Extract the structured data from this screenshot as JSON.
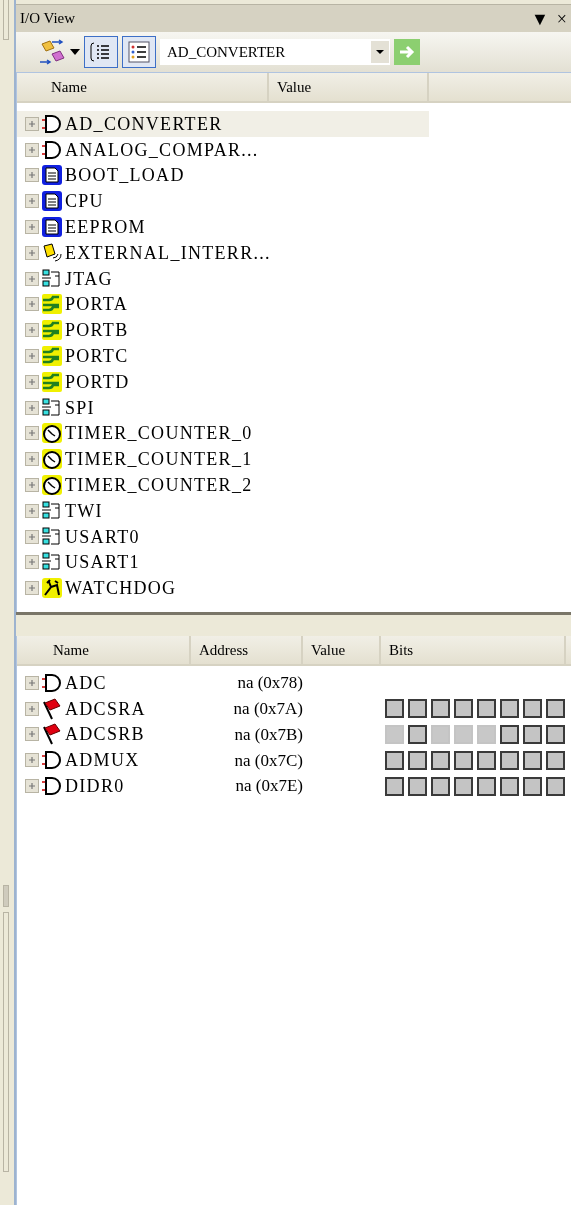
{
  "window": {
    "title": "I/O View",
    "menu_glyph": "▼",
    "close_glyph": "×"
  },
  "toolbar": {
    "view_toggles": [
      {
        "kind": "tree",
        "pressed": true
      },
      {
        "kind": "list",
        "pressed": true
      }
    ],
    "module_select": {
      "value": "AD_CONVERTER"
    }
  },
  "modules": {
    "columns": [
      "Name",
      "Value"
    ],
    "items": [
      {
        "name": "AD_CONVERTER",
        "kind": "gate",
        "selected": true
      },
      {
        "name": "ANALOG_COMPAR...",
        "kind": "gate",
        "selected": false
      },
      {
        "name": "BOOT_LOAD",
        "kind": "doc",
        "selected": false
      },
      {
        "name": "CPU",
        "kind": "doc",
        "selected": false
      },
      {
        "name": "EEPROM",
        "kind": "doc",
        "selected": false
      },
      {
        "name": "EXTERNAL_INTERR...",
        "kind": "bell",
        "selected": false
      },
      {
        "name": "JTAG",
        "kind": "serial",
        "selected": false
      },
      {
        "name": "PORTA",
        "kind": "port",
        "selected": false
      },
      {
        "name": "PORTB",
        "kind": "port",
        "selected": false
      },
      {
        "name": "PORTC",
        "kind": "port",
        "selected": false
      },
      {
        "name": "PORTD",
        "kind": "port",
        "selected": false
      },
      {
        "name": "SPI",
        "kind": "serial",
        "selected": false
      },
      {
        "name": "TIMER_COUNTER_0",
        "kind": "timer",
        "selected": false
      },
      {
        "name": "TIMER_COUNTER_1",
        "kind": "timer",
        "selected": false
      },
      {
        "name": "TIMER_COUNTER_2",
        "kind": "timer",
        "selected": false
      },
      {
        "name": "TWI",
        "kind": "serial",
        "selected": false
      },
      {
        "name": "USART0",
        "kind": "serial",
        "selected": false
      },
      {
        "name": "USART1",
        "kind": "serial",
        "selected": false
      },
      {
        "name": "WATCHDOG",
        "kind": "watchdog",
        "selected": false
      }
    ]
  },
  "registers": {
    "columns": [
      "Name",
      "Address",
      "Value",
      "Bits"
    ],
    "rows": [
      {
        "name": "ADC",
        "kind": "gate",
        "address": "na (0x78)"
      },
      {
        "name": "ADCSRA",
        "kind": "flag",
        "address": "na (0x7A)",
        "bits": [
          {
            "available": true
          },
          {
            "available": true
          },
          {
            "available": true
          },
          {
            "available": true
          },
          {
            "available": true
          },
          {
            "available": true
          },
          {
            "available": true
          },
          {
            "available": true
          }
        ]
      },
      {
        "name": "ADCSRB",
        "kind": "flag",
        "address": "na (0x7B)",
        "bits": [
          {
            "available": false
          },
          {
            "available": true
          },
          {
            "available": false
          },
          {
            "available": false
          },
          {
            "available": false
          },
          {
            "available": true
          },
          {
            "available": true
          },
          {
            "available": true
          }
        ]
      },
      {
        "name": "ADMUX",
        "kind": "gate",
        "address": "na (0x7C)",
        "bits": [
          {
            "available": true
          },
          {
            "available": true
          },
          {
            "available": true
          },
          {
            "available": true
          },
          {
            "available": true
          },
          {
            "available": true
          },
          {
            "available": true
          },
          {
            "available": true
          }
        ]
      },
      {
        "name": "DIDR0",
        "kind": "gate",
        "address": "na (0x7E)",
        "bits": [
          {
            "available": true
          },
          {
            "available": true
          },
          {
            "available": true
          },
          {
            "available": true
          },
          {
            "available": true
          },
          {
            "available": true
          },
          {
            "available": true
          },
          {
            "available": true
          }
        ]
      }
    ]
  }
}
